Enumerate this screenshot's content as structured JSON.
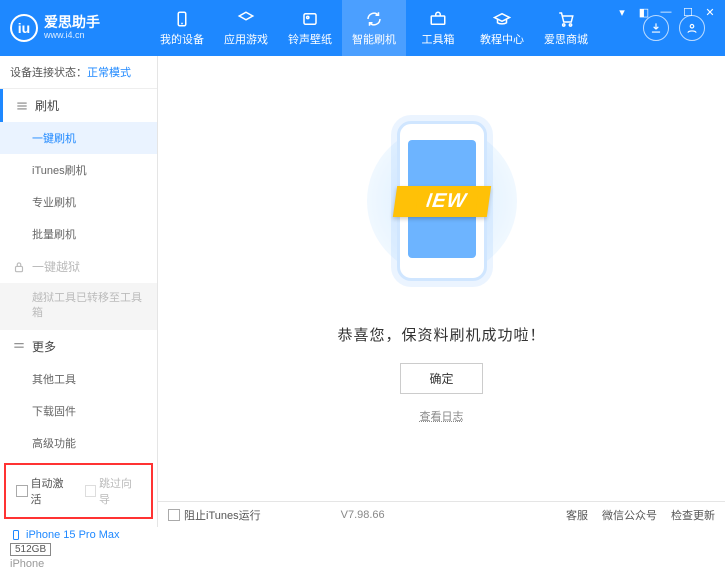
{
  "app": {
    "title": "爱思助手",
    "subtitle": "www.i4.cn",
    "logo_letter": "iu"
  },
  "nav": {
    "items": [
      {
        "label": "我的设备"
      },
      {
        "label": "应用游戏"
      },
      {
        "label": "铃声壁纸"
      },
      {
        "label": "智能刷机"
      },
      {
        "label": "工具箱"
      },
      {
        "label": "教程中心"
      },
      {
        "label": "爱思商城"
      }
    ],
    "active_index": 3
  },
  "status": {
    "label": "设备连接状态：",
    "value": "正常模式"
  },
  "sidebar": {
    "section_flash": "刷机",
    "items_flash": [
      {
        "label": "一键刷机"
      },
      {
        "label": "iTunes刷机"
      },
      {
        "label": "专业刷机"
      },
      {
        "label": "批量刷机"
      }
    ],
    "active_flash_index": 0,
    "section_jailbreak": "一键越狱",
    "jailbreak_note": "越狱工具已转移至工具箱",
    "section_more": "更多",
    "items_more": [
      {
        "label": "其他工具"
      },
      {
        "label": "下载固件"
      },
      {
        "label": "高级功能"
      }
    ]
  },
  "options": {
    "auto_activate": "自动激活",
    "skip_guide": "跳过向导"
  },
  "device": {
    "name": "iPhone 15 Pro Max",
    "storage": "512GB",
    "type": "iPhone"
  },
  "main": {
    "ribbon": "NEW",
    "success_msg": "恭喜您，保资料刷机成功啦！",
    "ok_button": "确定",
    "view_log": "查看日志"
  },
  "footer": {
    "block_itunes": "阻止iTunes运行",
    "version": "V7.98.66",
    "links": [
      "客服",
      "微信公众号",
      "检查更新"
    ]
  }
}
